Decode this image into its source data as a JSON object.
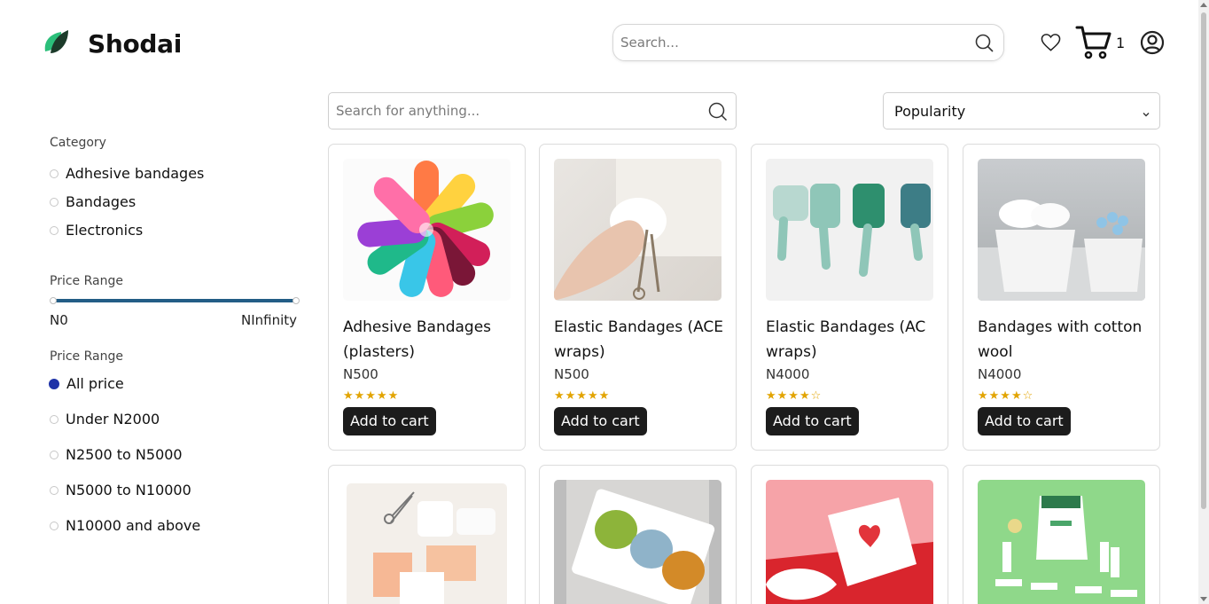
{
  "brand": {
    "name": "Shodai",
    "logo_icon": "leaf-logo-icon",
    "accent": "#2bbf7a"
  },
  "header": {
    "search_placeholder": "Search...",
    "cart_count": "1",
    "icons": [
      "search-icon",
      "heart-icon",
      "cart-icon",
      "user-icon"
    ]
  },
  "sidebar": {
    "category_title": "Category",
    "categories": [
      "Adhesive bandages",
      "Bandages",
      "Electronics"
    ],
    "price_range_title": "Price Range",
    "price_min": "N0",
    "price_max": "NInfinity",
    "price_filter_title": "Price Range",
    "price_options": [
      "All price",
      "Under N2000",
      "N2500 to N5000",
      "N5000 to N10000",
      "N10000 and above"
    ],
    "selected_price_option": "All price",
    "selected_color": "#1f33a8"
  },
  "toolbar": {
    "search_placeholder": "Search for anything...",
    "sort_value": "Popularity"
  },
  "products": [
    {
      "name": "Adhesive Bandages (plasters)",
      "price": "N500",
      "stars": "★★★★★",
      "button": "Add to cart"
    },
    {
      "name": "Elastic Bandages (ACE wraps)",
      "price": "N500",
      "stars": "★★★★★",
      "button": "Add to cart"
    },
    {
      "name": "Elastic Bandages (AC wraps)",
      "price": "N4000",
      "stars": "★★★★☆",
      "button": "Add to cart"
    },
    {
      "name": "Bandages with cotton wool",
      "price": "N4000",
      "stars": "★★★★☆",
      "button": "Add to cart"
    },
    {
      "name": "",
      "price": "",
      "stars": "",
      "button": ""
    },
    {
      "name": "",
      "price": "",
      "stars": "",
      "button": ""
    },
    {
      "name": "",
      "price": "",
      "stars": "",
      "button": ""
    },
    {
      "name": "",
      "price": "",
      "stars": "",
      "button": ""
    }
  ]
}
